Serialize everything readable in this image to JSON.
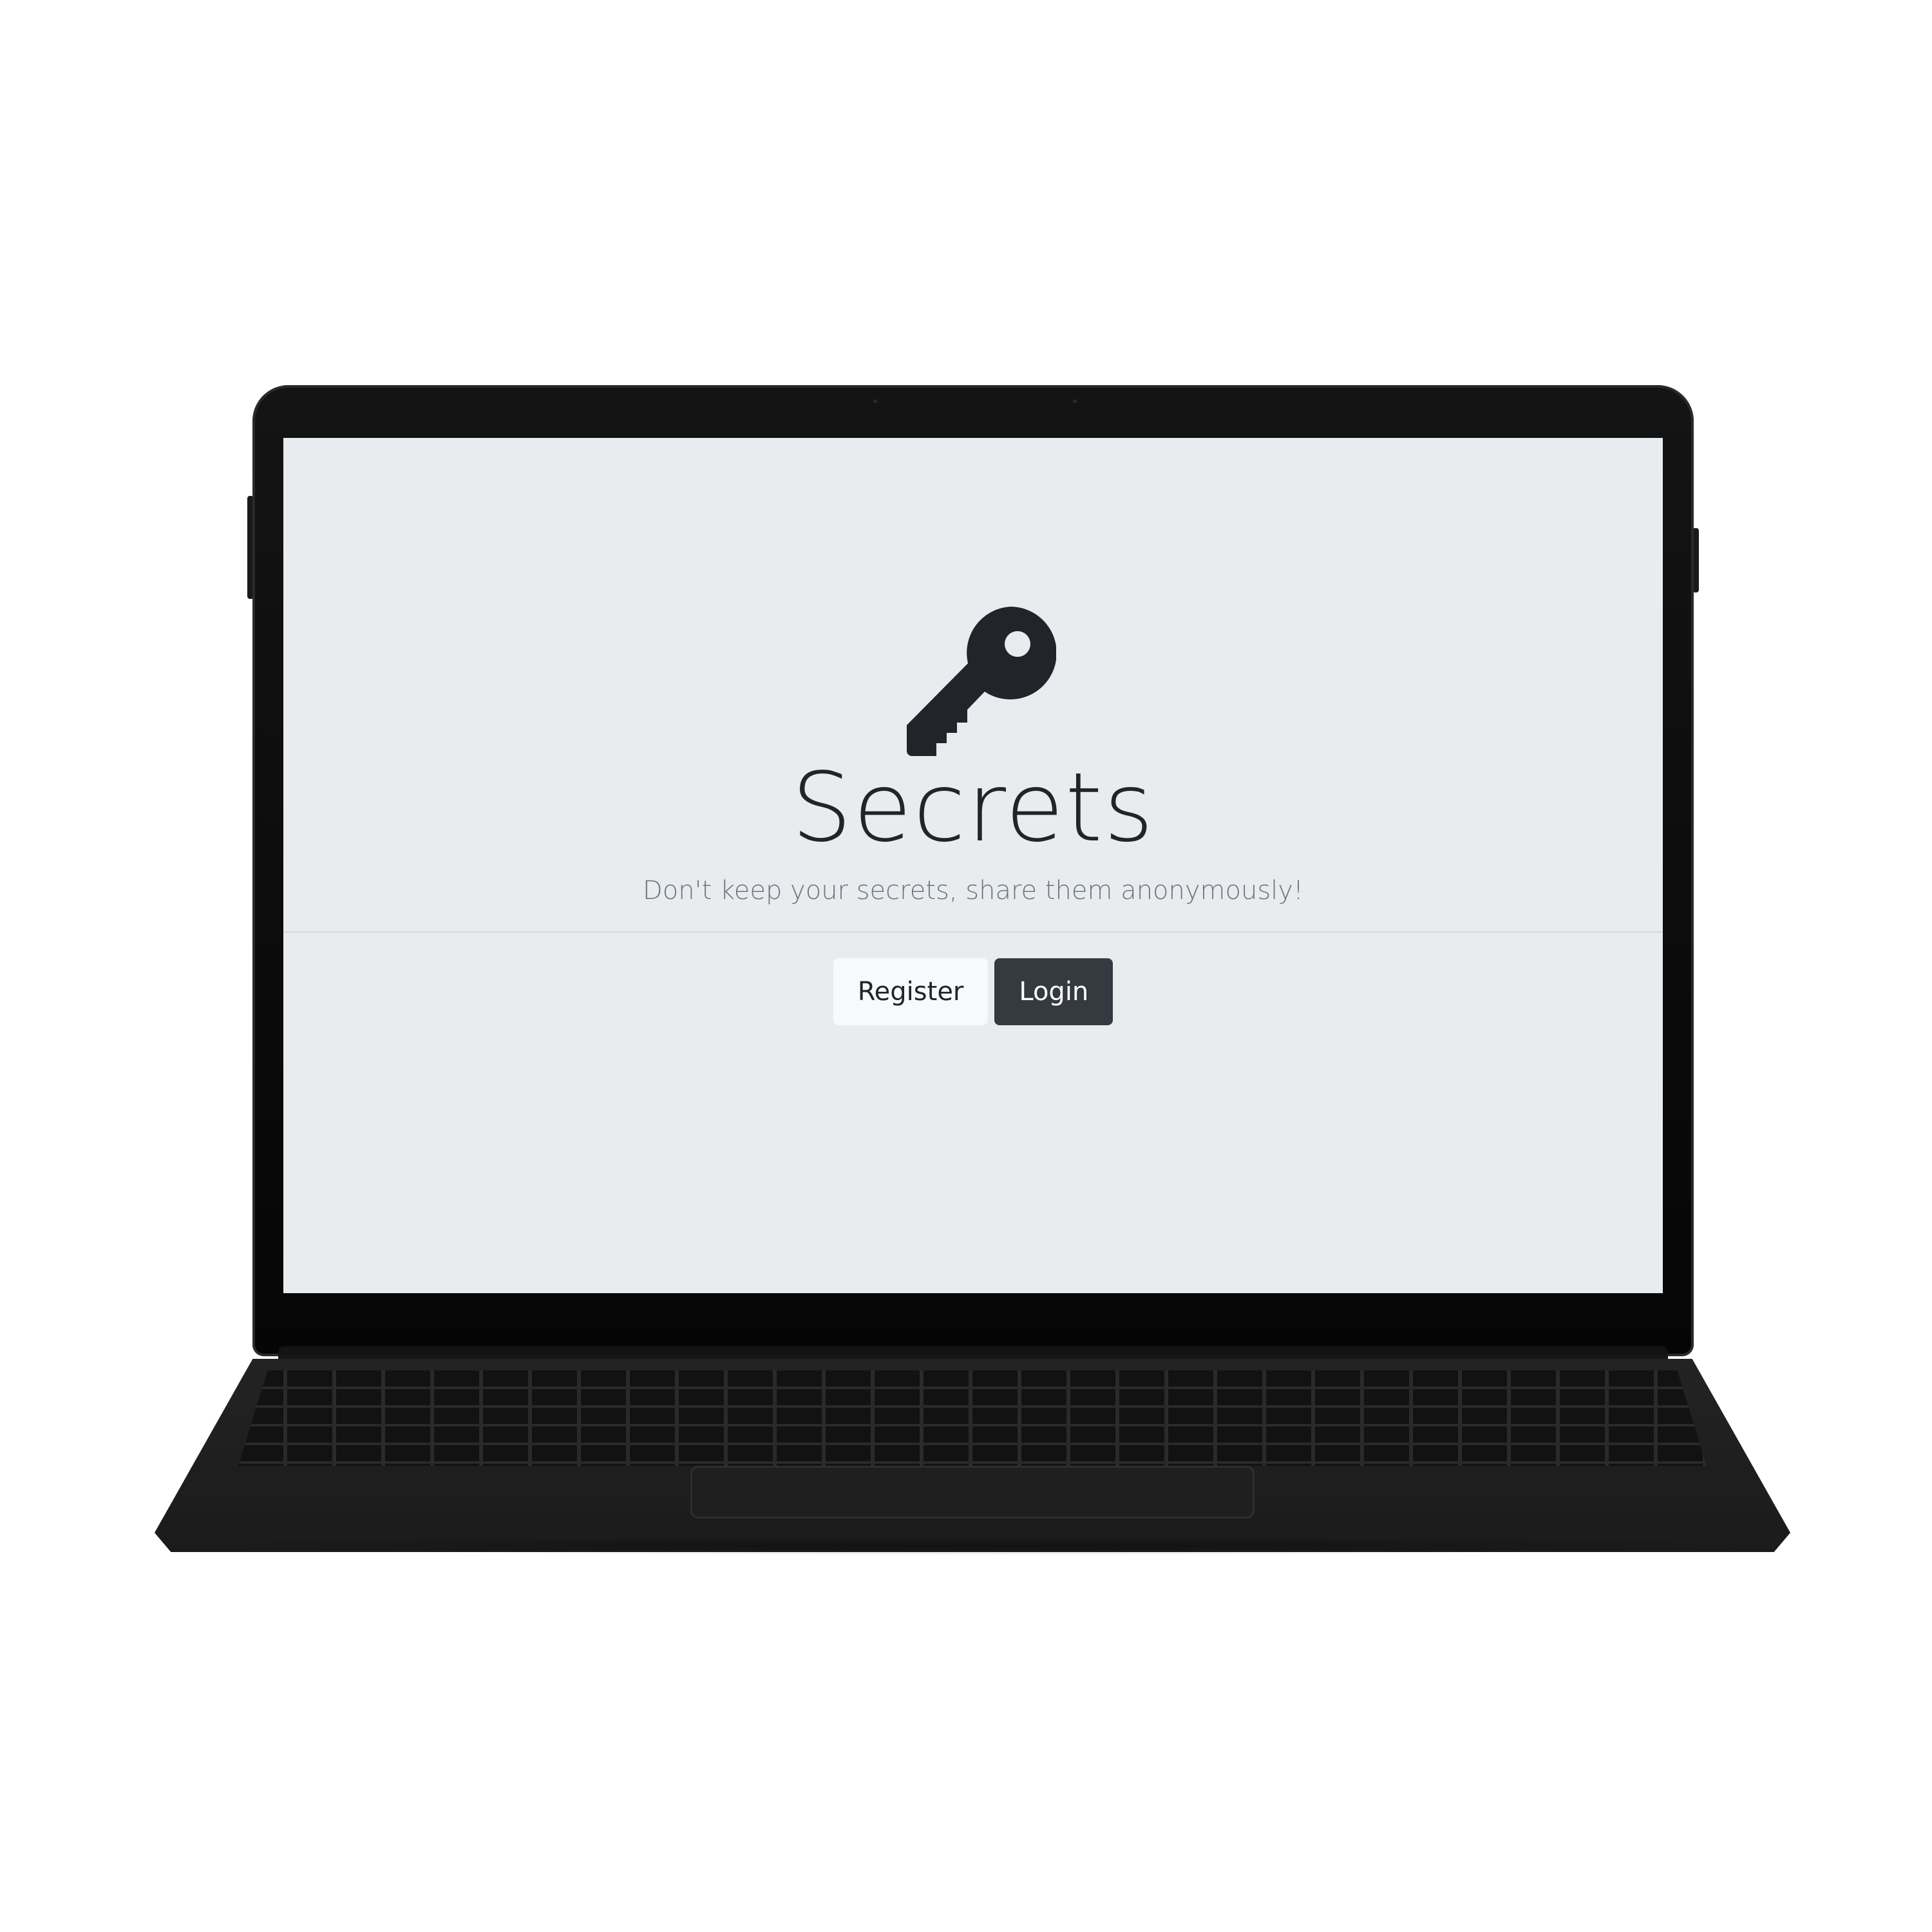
{
  "app": {
    "title": "Secrets",
    "subtitle": "Don't keep your secrets, share them anonymously!",
    "icon": "key-icon"
  },
  "actions": {
    "register_label": "Register",
    "login_label": "Login"
  },
  "colors": {
    "page_background": "#e9ecef",
    "text_primary": "#212529",
    "text_muted": "#6c757d",
    "register_button": "#f8f9fa",
    "login_button": "#343a40"
  }
}
